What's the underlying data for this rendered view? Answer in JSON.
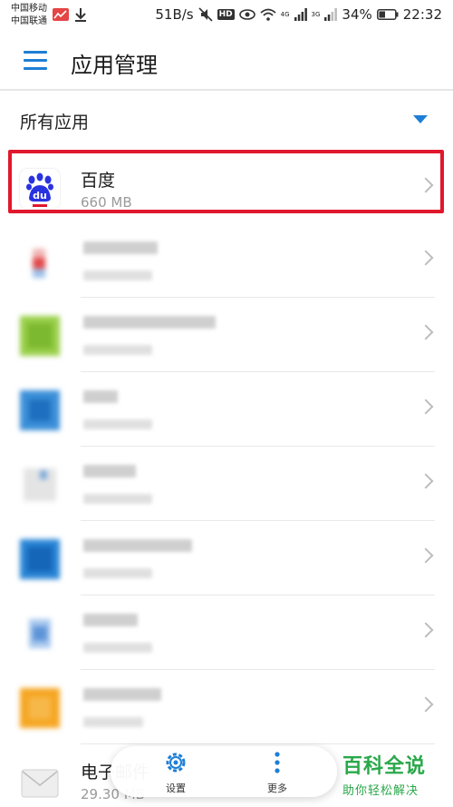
{
  "status_bar": {
    "carrier_1": "中国移动",
    "carrier_2": "中国联通",
    "net_speed": "51B/s",
    "battery": "34%",
    "time": "22:32",
    "net_4g": "4G",
    "net_3g": "3G",
    "hd": "HD"
  },
  "header": {
    "title": "应用管理"
  },
  "filter": {
    "label": "所有应用"
  },
  "apps": [
    {
      "name": "百度",
      "size": "660 MB"
    },
    {
      "name": "电子邮件",
      "size": "29.30 MB"
    }
  ],
  "bottom_bar": {
    "settings_label": "设置",
    "more_label": "更多"
  },
  "watermark": {
    "main": "百科全说",
    "sub": "助你轻松解决"
  },
  "colors": {
    "accent": "#1e7ed6",
    "highlight": "#e0182d",
    "watermark": "#2aa84a"
  }
}
